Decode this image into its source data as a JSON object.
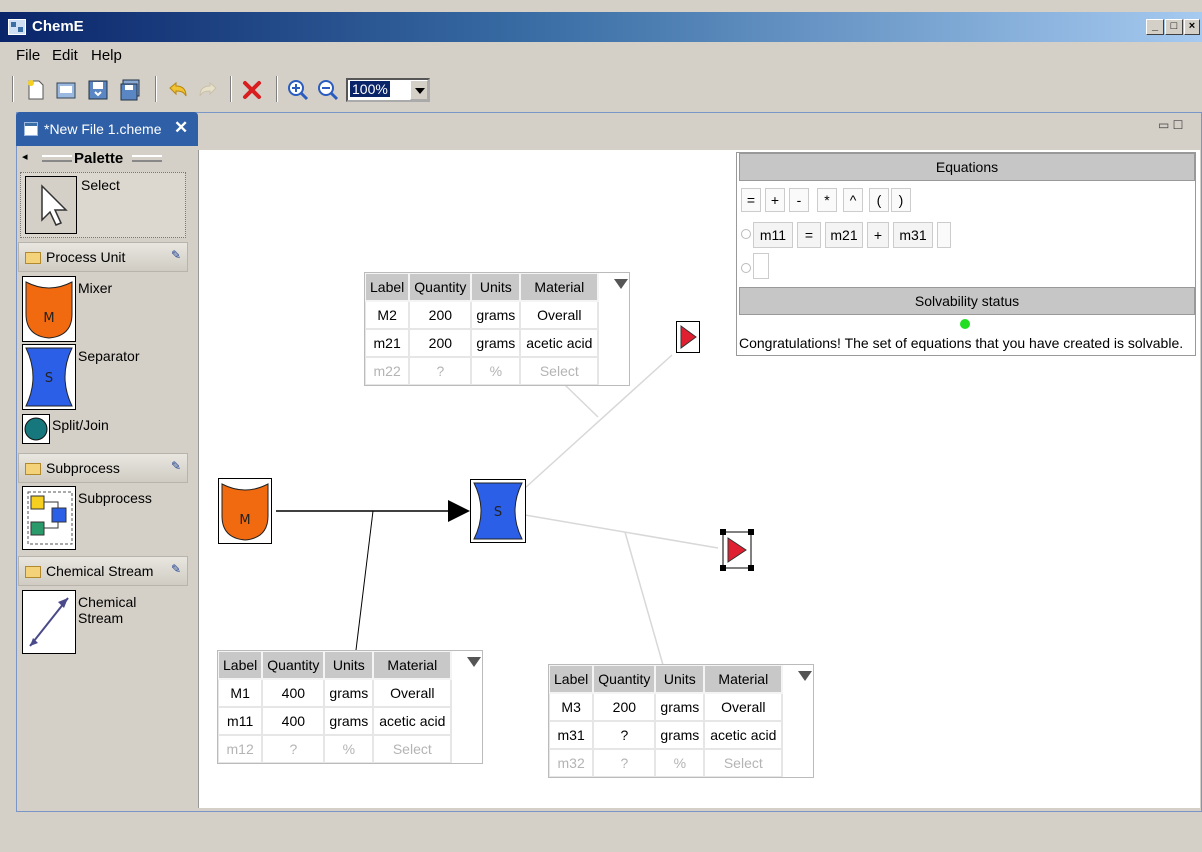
{
  "window": {
    "title": "ChemE"
  },
  "menu": [
    "File",
    "Edit",
    "Help"
  ],
  "toolbar": {
    "zoom": "100%"
  },
  "tab": {
    "label": "*New File 1.cheme"
  },
  "palette": {
    "title": "Palette",
    "select_label": "Select",
    "drawers": [
      {
        "label": "Process Unit",
        "items": [
          "Mixer",
          "Separator",
          "Split/Join"
        ]
      },
      {
        "label": "Subprocess",
        "items": [
          "Subprocess"
        ]
      },
      {
        "label": "Chemical Stream",
        "items": [
          "Chemical Stream"
        ]
      }
    ]
  },
  "units": {
    "mixer_letter": "M",
    "separator_letter": "S"
  },
  "tables": [
    {
      "header": [
        "Label",
        "Quantity",
        "Units",
        "Material"
      ],
      "rows": [
        [
          "M2",
          "200",
          "grams",
          "Overall"
        ],
        [
          "m21",
          "200",
          "grams",
          "acetic acid"
        ]
      ],
      "new_row": [
        "m22",
        "?",
        "%",
        "Select"
      ]
    },
    {
      "header": [
        "Label",
        "Quantity",
        "Units",
        "Material"
      ],
      "rows": [
        [
          "M1",
          "400",
          "grams",
          "Overall"
        ],
        [
          "m11",
          "400",
          "grams",
          "acetic acid"
        ]
      ],
      "new_row": [
        "m12",
        "?",
        "%",
        "Select"
      ]
    },
    {
      "header": [
        "Label",
        "Quantity",
        "Units",
        "Material"
      ],
      "rows": [
        [
          "M3",
          "200",
          "grams",
          "Overall"
        ],
        [
          "m31",
          "?",
          "grams",
          "acetic acid"
        ]
      ],
      "new_row": [
        "m32",
        "?",
        "%",
        "Select"
      ]
    }
  ],
  "equations": {
    "title": "Equations",
    "operators": [
      "=",
      "+",
      "-",
      "*",
      "^",
      "(",
      ")"
    ],
    "equation": [
      "m11",
      "=",
      "m21",
      "+",
      "m31"
    ],
    "status_title": "Solvability status",
    "status_message": "Congratulations! The set of equations that you have created is solvable.",
    "status_color": "#22dd22"
  },
  "colors": {
    "mixer": "#f26a10",
    "separator": "#2b5fe8",
    "split": "#16787c",
    "stream_arrow": "#e02030"
  }
}
